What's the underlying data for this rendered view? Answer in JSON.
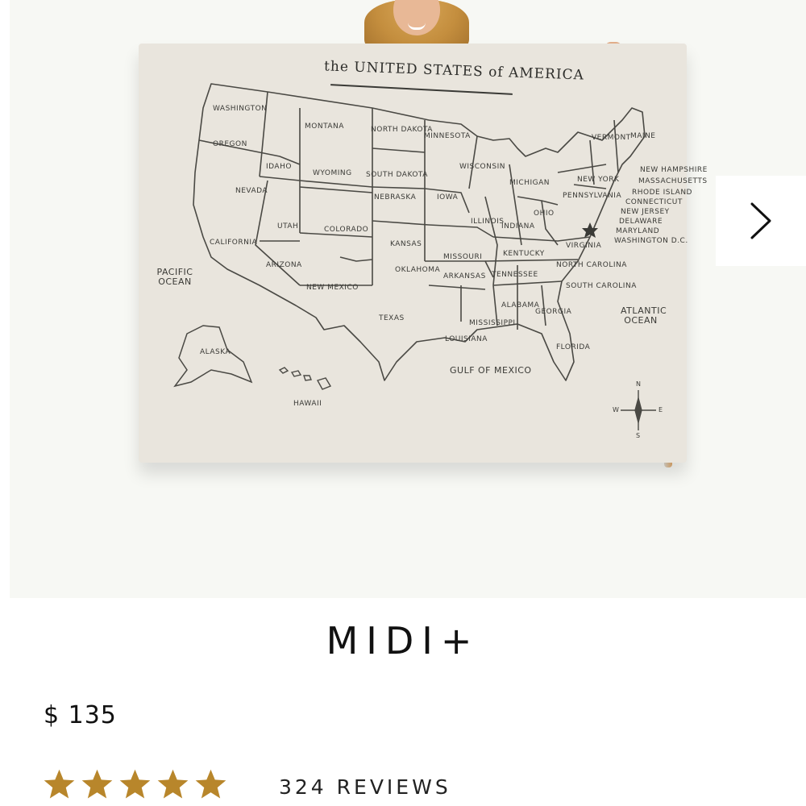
{
  "product": {
    "title": "MIDI+",
    "price": "$ 135",
    "rating": {
      "value": 5,
      "max": 5,
      "star_color": "#b8862b"
    },
    "reviews_label": "324 REVIEWS"
  },
  "gallery": {
    "next_icon": "chevron-right-icon"
  },
  "map": {
    "title": "the UNITED STATES of AMERICA",
    "states": [
      "WASHINGTON",
      "OREGON",
      "IDAHO",
      "MONTANA",
      "WYOMING",
      "NORTH DAKOTA",
      "SOUTH DAKOTA",
      "MINNESOTA",
      "NEVADA",
      "UTAH",
      "COLORADO",
      "NEBRASKA",
      "IOWA",
      "WISCONSIN",
      "MICHIGAN",
      "CALIFORNIA",
      "ARIZONA",
      "NEW MEXICO",
      "KANSAS",
      "MISSOURI",
      "ILLINOIS",
      "INDIANA",
      "OHIO",
      "OKLAHOMA",
      "TEXAS",
      "ARKANSAS",
      "TENNESSEE",
      "KENTUCKY",
      "VIRGINIA",
      "NORTH CAROLINA",
      "SOUTH CAROLINA",
      "GEORGIA",
      "ALABAMA",
      "MISSISSIPPI",
      "LOUISIANA",
      "FLORIDA",
      "PENNSYLVANIA",
      "NEW YORK",
      "VERMONT",
      "MAINE",
      "NEW HAMPSHIRE",
      "MASSACHUSETTS",
      "RHODE ISLAND",
      "CONNECTICUT",
      "NEW JERSEY",
      "DELAWARE",
      "MARYLAND",
      "WASHINGTON D.C.",
      "ALASKA",
      "HAWAII"
    ],
    "oceans": {
      "pacific": "PACIFIC OCEAN",
      "atlantic": "ATLANTIC OCEAN",
      "gulf": "GULF of MEXICO"
    },
    "compass": {
      "n": "N",
      "s": "S",
      "e": "E",
      "w": "W"
    }
  }
}
